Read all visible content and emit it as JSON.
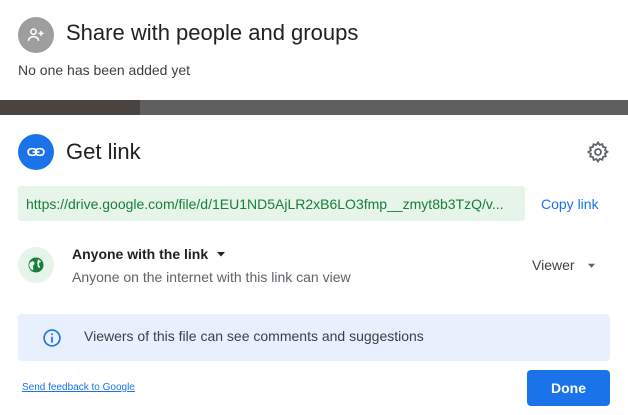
{
  "share": {
    "title": "Share with people and groups",
    "subtitle": "No one has been added yet",
    "icon": "person-add-icon"
  },
  "link": {
    "title": "Get link",
    "icon": "link-icon",
    "settings_icon": "gear-icon",
    "url": "https://drive.google.com/file/d/1EU1ND5AjLR2xB6LO3fmp__zmyt8b3TzQ/v...",
    "copy_label": "Copy link"
  },
  "access": {
    "icon": "globe-icon",
    "label": "Anyone with the link",
    "description": "Anyone on the internet with this link can view",
    "role": "Viewer"
  },
  "info": {
    "icon": "info-icon",
    "text": "Viewers of this file can see comments and suggestions"
  },
  "footer": {
    "feedback_label": "Send feedback to Google",
    "done_label": "Done"
  },
  "colors": {
    "accent": "#1a73e8",
    "link_green": "#188038",
    "url_bg": "#e6f4ea",
    "info_bg": "#e8f0fe"
  }
}
